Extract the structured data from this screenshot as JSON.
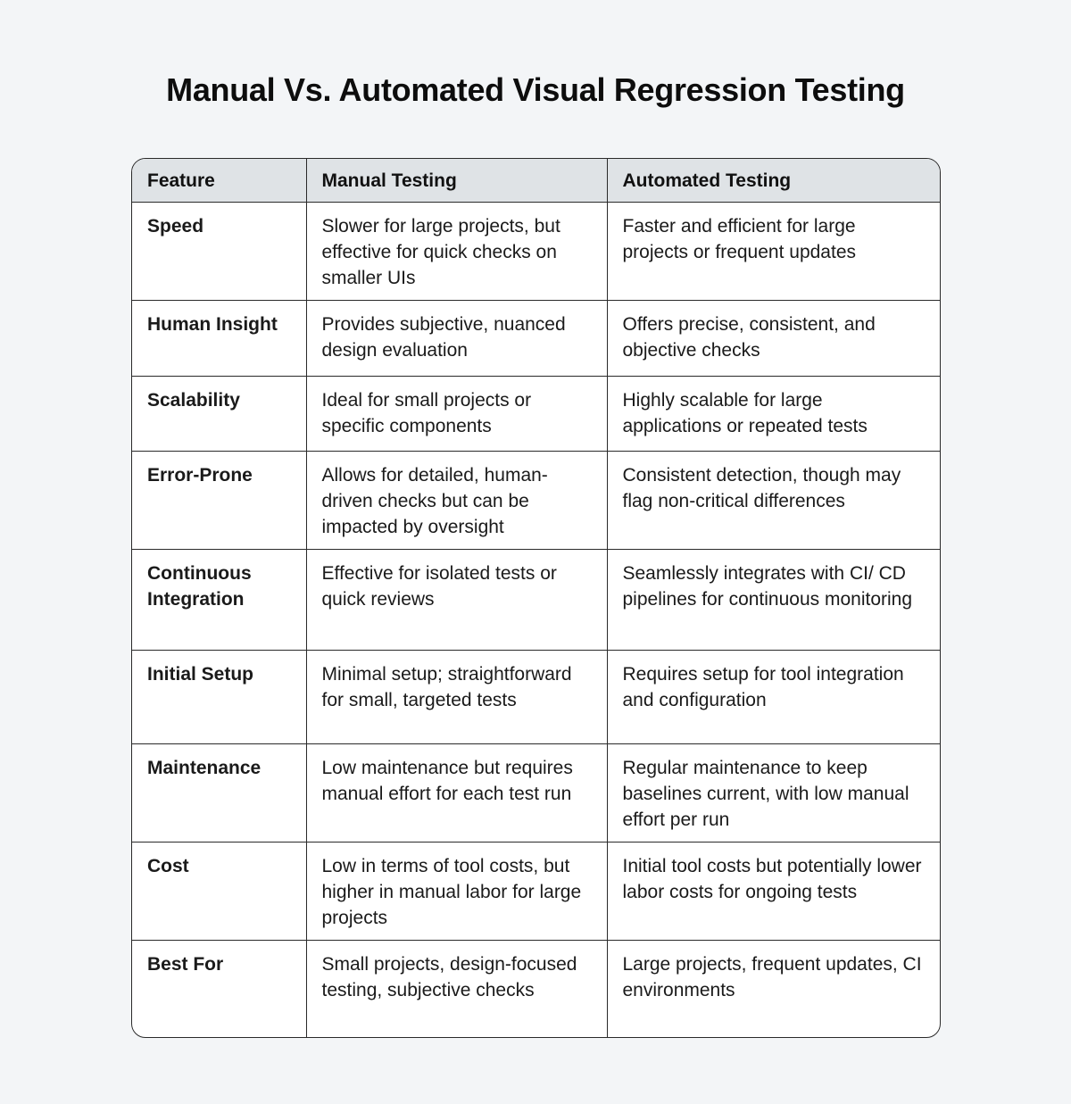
{
  "title": "Manual Vs. Automated Visual Regression Testing",
  "table": {
    "headers": [
      "Feature",
      "Manual Testing",
      "Automated Testing"
    ],
    "rows": [
      {
        "feature": "Speed",
        "manual": "Slower for large projects, but effective for quick checks on smaller UIs",
        "automated": "Faster and efficient for large projects or frequent updates"
      },
      {
        "feature": "Human Insight",
        "manual": "Provides subjective, nuanced design evaluation",
        "automated": "Offers precise, consistent, and objective checks"
      },
      {
        "feature": "Scalability",
        "manual": "Ideal for small projects or specific components",
        "automated": "Highly scalable for large applications or repeated tests"
      },
      {
        "feature": "Error-Prone",
        "manual": "Allows for detailed, human-driven checks but can be impacted by oversight",
        "automated": "Consistent detection, though may flag non-critical differences"
      },
      {
        "feature": "Continuous Integration",
        "manual": "Effective for isolated tests or quick reviews",
        "automated": "Seamlessly integrates with CI/ CD pipelines for continuous monitoring"
      },
      {
        "feature": "Initial Setup",
        "manual": "Minimal setup; straightforward for small, targeted tests",
        "automated": "Requires setup for tool integration and configuration"
      },
      {
        "feature": "Maintenance",
        "manual": "Low maintenance but requires manual effort for each test run",
        "automated": "Regular maintenance to keep baselines current, with low manual effort per run"
      },
      {
        "feature": "Cost",
        "manual": "Low in terms of tool costs, but higher in manual labor for large projects",
        "automated": "Initial tool costs but potentially lower labor costs for ongoing tests"
      },
      {
        "feature": "Best For",
        "manual": "Small projects, design-focused testing, subjective checks",
        "automated": "Large projects, frequent updates, CI environments"
      }
    ]
  }
}
